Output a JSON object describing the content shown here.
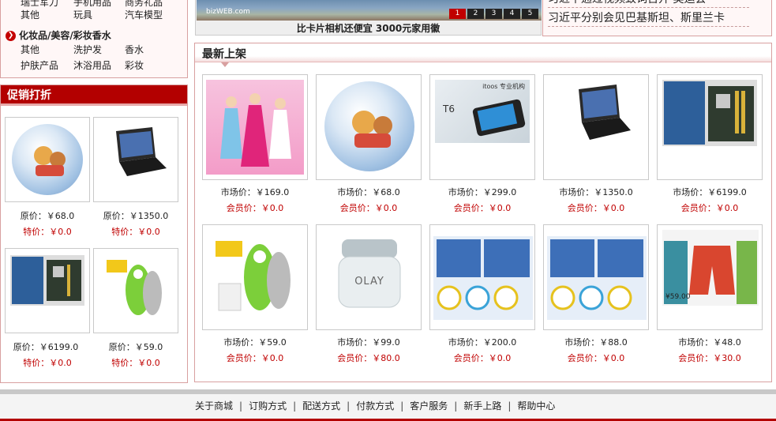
{
  "category_nav": {
    "row_top_partial": [
      "瑞士军刀",
      "手机用品",
      "商务礼品"
    ],
    "row_toys": [
      "其他",
      "玩具",
      "汽车模型"
    ],
    "cosmetics_title": "化妆品/美容/彩妆香水",
    "row_cos1": [
      "其他",
      "洗护发",
      "香水"
    ],
    "row_cos2": [
      "护肤产品",
      "沐浴用品",
      "彩妆"
    ]
  },
  "promo": {
    "title": "促销打折",
    "items": [
      {
        "orig": "原价：￥68.0",
        "sale": "特价：￥0.0",
        "icon": "winnie-ball-icon"
      },
      {
        "orig": "原价：￥1350.0",
        "sale": "特价：￥0.0",
        "icon": "laptop-icon"
      },
      {
        "orig": "原价：￥6199.0",
        "sale": "特价：￥0.0",
        "icon": "motherboard-icon"
      },
      {
        "orig": "原价：￥59.0",
        "sale": "特价：￥0.0",
        "icon": "lint-shaver-icon"
      }
    ]
  },
  "banner": {
    "caption": "比卡片相机还便宜 3000元家用徽",
    "logo_text": "bizWEB.com",
    "slides": [
      "1",
      "2",
      "3",
      "4",
      "5"
    ]
  },
  "news": {
    "lines": [
      "习近平通过视频致词召开 奥运会",
      "习近平分别会见巴基斯坦、斯里兰卡"
    ]
  },
  "new_arrivals": {
    "title": "最新上架",
    "products": [
      {
        "market": "市场价：￥169.0",
        "member": "会员价：￥0.0",
        "icon": "barbie-doll-icon"
      },
      {
        "market": "市场价：￥68.0",
        "member": "会员价：￥0.0",
        "icon": "winnie-ball-icon"
      },
      {
        "market": "市场价：￥299.0",
        "member": "会员价：￥0.0",
        "icon": "phone-t6-icon"
      },
      {
        "market": "市场价：￥1350.0",
        "member": "会员价：￥0.0",
        "icon": "laptop-icon"
      },
      {
        "market": "市场价：￥6199.0",
        "member": "会员价：￥0.0",
        "icon": "motherboard-icon"
      },
      {
        "market": "市场价：￥59.0",
        "member": "会员价：￥0.0",
        "icon": "lint-shaver-icon"
      },
      {
        "market": "市场价：￥99.0",
        "member": "会员价：￥80.0",
        "icon": "olay-cream-icon"
      },
      {
        "market": "市场价：￥200.0",
        "member": "会员价：￥0.0",
        "icon": "mask-pack-icon"
      },
      {
        "market": "市场价：￥88.0",
        "member": "会员价：￥0.0",
        "icon": "mask-pack-icon"
      },
      {
        "market": "市场价：￥48.0",
        "member": "会员价：￥30.0",
        "icon": "shorts-icon"
      }
    ],
    "olay_text": "OLAY",
    "phone_brand": "itoos 专业机构",
    "phone_model": "T6",
    "shorts_price": "¥59.00"
  },
  "footer": {
    "links": [
      "关于商城",
      "订购方式",
      "配送方式",
      "付款方式",
      "客户服务",
      "新手上路",
      "帮助中心"
    ],
    "separator": "|"
  },
  "colors": {
    "accent": "#b30000",
    "sale_red": "#c00000",
    "border_pink": "#d8a0a0"
  }
}
